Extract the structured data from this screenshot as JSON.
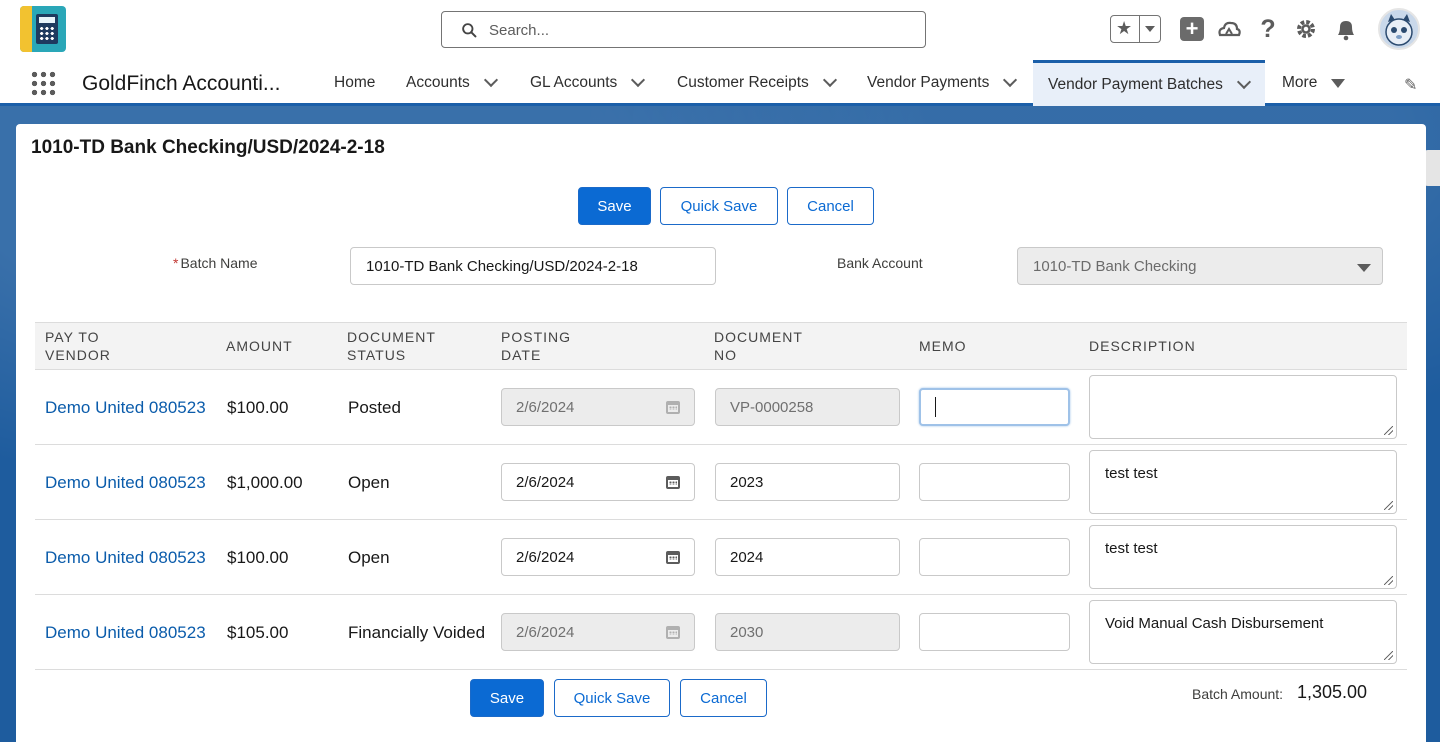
{
  "header": {
    "search_placeholder": "Search...",
    "icons": [
      "favorites-star-icon",
      "add-icon",
      "trailhead-icon",
      "help-icon",
      "setup-gear-icon",
      "notifications-bell-icon",
      "avatar"
    ]
  },
  "nav": {
    "app_name": "GoldFinch Accounti...",
    "items": [
      {
        "label": "Home"
      },
      {
        "label": "Accounts"
      },
      {
        "label": "GL Accounts"
      },
      {
        "label": "Customer Receipts"
      },
      {
        "label": "Vendor Payments"
      },
      {
        "label": "Vendor Payment Batches"
      },
      {
        "label": "More"
      }
    ]
  },
  "page": {
    "title": "1010-TD Bank Checking/USD/2024-2-18",
    "buttons": {
      "save": "Save",
      "quick_save": "Quick Save",
      "cancel": "Cancel"
    },
    "batch_name_label": "Batch Name",
    "batch_name_required": "*",
    "batch_name_value": "1010-TD Bank Checking/USD/2024-2-18",
    "bank_account_label": "Bank Account",
    "bank_account_value": "1010-TD Bank Checking"
  },
  "table": {
    "headers": {
      "vendor_1": "PAY TO",
      "vendor_2": "VENDOR",
      "amount": "AMOUNT",
      "status_1": "DOCUMENT",
      "status_2": "STATUS",
      "date_1": "POSTING",
      "date_2": "DATE",
      "docno_1": "DOCUMENT",
      "docno_2": "NO",
      "memo": "MEMO",
      "description": "DESCRIPTION"
    },
    "rows": [
      {
        "vendor": "Demo United 080523",
        "amount": "$100.00",
        "status": "Posted",
        "date": "2/6/2024",
        "doc_no": "VP-0000258",
        "memo": "",
        "description": ""
      },
      {
        "vendor": "Demo United 080523",
        "amount": "$1,000.00",
        "status": "Open",
        "date": "2/6/2024",
        "doc_no": "2023",
        "memo": "",
        "description": "test test"
      },
      {
        "vendor": "Demo United 080523",
        "amount": "$100.00",
        "status": "Open",
        "date": "2/6/2024",
        "doc_no": "2024",
        "memo": "",
        "description": "test test"
      },
      {
        "vendor": "Demo United 080523",
        "amount": "$105.00",
        "status": "Financially Voided",
        "date": "2/6/2024",
        "doc_no": "2030",
        "memo": "",
        "description": "Void Manual Cash Disbursement"
      }
    ]
  },
  "footer": {
    "batch_amount_label": "Batch Amount:",
    "batch_amount_value": "1,305.00"
  },
  "colors": {
    "brand": "#0b6ad3",
    "nav_active": "#1b5fa9",
    "link": "#0b5cab"
  }
}
